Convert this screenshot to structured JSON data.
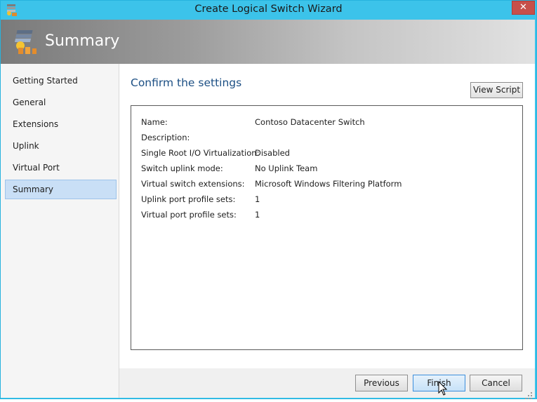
{
  "window": {
    "title": "Create Logical Switch Wizard",
    "close_glyph": "✕"
  },
  "banner": {
    "title": "Summary",
    "icon": "wizard-switch-icon"
  },
  "nav": {
    "items": [
      {
        "label": "Getting Started",
        "selected": false
      },
      {
        "label": "General",
        "selected": false
      },
      {
        "label": "Extensions",
        "selected": false
      },
      {
        "label": "Uplink",
        "selected": false
      },
      {
        "label": "Virtual Port",
        "selected": false
      },
      {
        "label": "Summary",
        "selected": true
      }
    ]
  },
  "main": {
    "heading": "Confirm the settings",
    "view_script_label": "View Script",
    "settings": [
      {
        "label": "Name:",
        "value": "Contoso Datacenter Switch"
      },
      {
        "label": "Description:",
        "value": ""
      },
      {
        "label": "Single Root I/O Virtualization:",
        "value": "Disabled"
      },
      {
        "label": "Switch uplink mode:",
        "value": "No Uplink Team"
      },
      {
        "label": "Virtual switch extensions:",
        "value": "Microsoft Windows Filtering Platform"
      },
      {
        "label": "Uplink port profile sets:",
        "value": "1"
      },
      {
        "label": "Virtual port profile sets:",
        "value": "1"
      }
    ]
  },
  "footer": {
    "previous_label": "Previous",
    "finish_label": "Finish",
    "cancel_label": "Cancel"
  },
  "colors": {
    "title_bar": "#3cc3ea",
    "close_button": "#c7504a",
    "heading": "#1c4f84",
    "selection": "#c9dff6"
  }
}
